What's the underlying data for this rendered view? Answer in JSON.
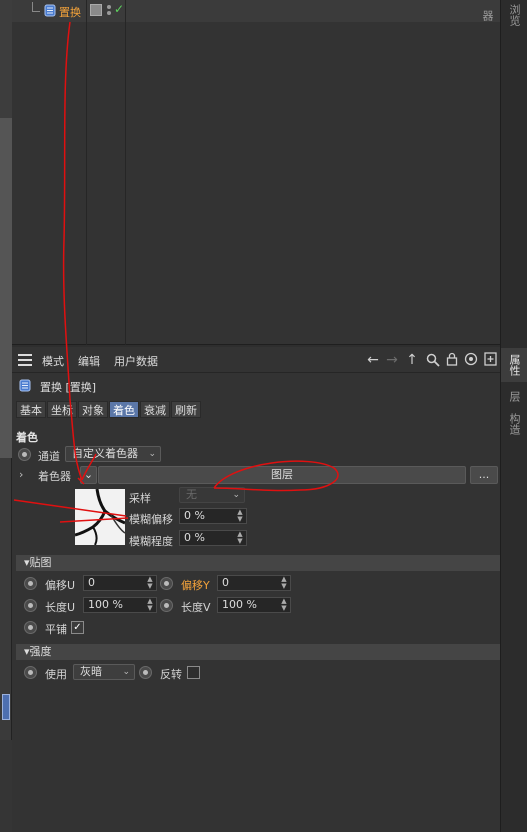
{
  "object_manager": {
    "object_name": "置换"
  },
  "right_tabs": [
    "浏览器",
    "属性",
    "层",
    "构造"
  ],
  "attr": {
    "menus": [
      "模式",
      "编辑",
      "用户数据"
    ],
    "header_title": "置换 [置换]",
    "tabs": [
      "基本",
      "坐标",
      "对象",
      "着色",
      "衰减",
      "刷新"
    ],
    "active_tab": "着色",
    "shading": {
      "section": "着色",
      "channel_label": "通道",
      "channel_value": "自定义着色器",
      "shader_label": "着色器",
      "shader_button": "图层",
      "more_button": "...",
      "sampling_label": "采样",
      "sampling_value": "无",
      "blur_offset_label": "模糊偏移",
      "blur_offset_value": "0 %",
      "blur_scale_label": "模糊程度",
      "blur_scale_value": "0 %"
    },
    "mapping": {
      "section": "贴图",
      "offset_u_label": "偏移U",
      "offset_u_value": "0",
      "offset_v_label": "偏移Y",
      "offset_v_value": "0",
      "length_u_label": "长度U",
      "length_u_value": "100 %",
      "length_v_label": "长度V",
      "length_v_value": "100 %",
      "tile_label": "平铺",
      "tile_checked": true
    },
    "intensity": {
      "section": "强度",
      "use_label": "使用",
      "use_value": "灰暗",
      "invert_label": "反转",
      "invert_checked": false
    }
  },
  "colors": {
    "accent_orange": "#f3a23a",
    "active_tab": "#5b77a8",
    "annotation_red": "#e01010"
  }
}
